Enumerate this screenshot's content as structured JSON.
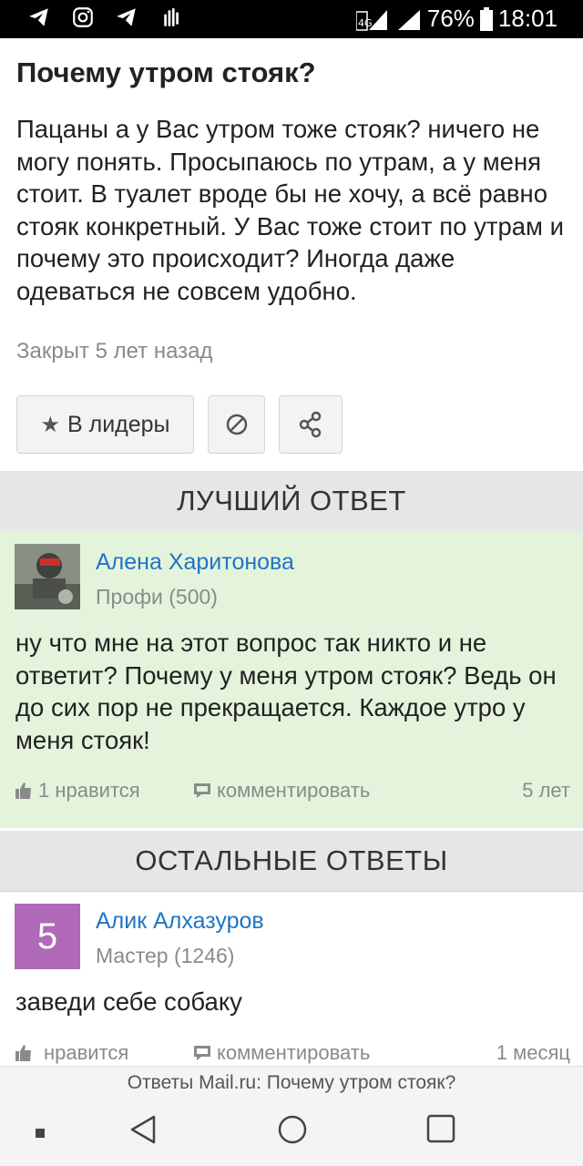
{
  "status_bar": {
    "battery": "76%",
    "time": "18:01",
    "network": "4G"
  },
  "question": {
    "title": "Почему утром стояк?",
    "body": "Пацаны а у Вас утром тоже стояк? ничего не могу понять. Просыпаюсь по утрам, а у меня стоит. В туалет вроде бы не хочу, а всё равно стояк конкретный. У Вас тоже стоит по утрам и почему это происходит? Иногда даже одеваться не совсем удобно.",
    "meta": "Закрыт 5 лет назад",
    "leader_button": "В лидеры"
  },
  "best_answer": {
    "header": "ЛУЧШИЙ ОТВЕТ",
    "author": "Алена Харитонова",
    "rank": "Профи (500)",
    "text": "ну что мне на этот вопрос так никто и не ответит? Почему у меня утром стояк? Ведь он до сих пор не прекращается. Каждое утро у меня стояк!",
    "likes": "1 нравится",
    "comment": "комментировать",
    "time": "5 лет"
  },
  "other_answers": {
    "header": "ОСТАЛЬНЫЕ ОТВЕТЫ",
    "items": [
      {
        "avatar_text": "5",
        "author": "Алик Алхазуров",
        "rank": "Мастер (1246)",
        "text": "заведи себе собаку",
        "likes": "нравится",
        "comment": "комментировать",
        "time": "1 месяц"
      }
    ]
  },
  "url_bar": "Ответы Mail.ru: Почему утром стояк?",
  "colors": {
    "accent_link": "#1f75c4",
    "best_bg": "#e4f4dc",
    "avatar_purple": "#b069b8"
  }
}
